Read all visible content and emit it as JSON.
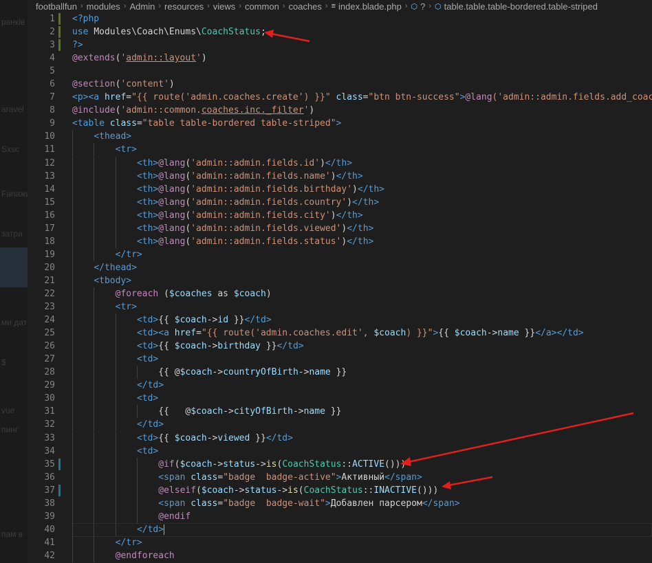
{
  "breadcrumb": [
    {
      "label": "footballfun",
      "icon": ""
    },
    {
      "label": "modules",
      "icon": ""
    },
    {
      "label": "Admin",
      "icon": ""
    },
    {
      "label": "resources",
      "icon": ""
    },
    {
      "label": "views",
      "icon": ""
    },
    {
      "label": "common",
      "icon": ""
    },
    {
      "label": "coaches",
      "icon": ""
    },
    {
      "label": "index.blade.php",
      "icon": "file-lines-icon"
    },
    {
      "label": "?",
      "icon": "cube-icon"
    },
    {
      "label": "table.table.table-bordered.table-striped",
      "icon": "cube-icon"
    }
  ],
  "sidebar_fragments": [
    "ранкiв",
    "aravel",
    "Sxsc",
    "Fanaжи",
    "затра",
    "ми дат",
    "$ ",
    "vue ",
    "пинг",
    "пам в"
  ],
  "colors": {
    "keyword": "#569cd6",
    "tag": "#569cd6",
    "attr": "#9cdcfe",
    "string": "#ce9178",
    "text": "#d4d4d4",
    "directive": "#c586c0",
    "function": "#dcdcaa",
    "class": "#4ec9b0",
    "php": "#569cd6",
    "arrow": "#e0201e"
  },
  "lines": [
    {
      "n": "1",
      "mark": "added",
      "segs": [
        [
          "<?php",
          "php"
        ]
      ]
    },
    {
      "n": "2",
      "mark": "added",
      "segs": [
        [
          "use ",
          "php"
        ],
        [
          "Modules\\Coach\\Enums\\",
          "text"
        ],
        [
          "CoachStatus",
          "class"
        ],
        [
          ";",
          "text"
        ]
      ]
    },
    {
      "n": "3",
      "mark": "added",
      "segs": [
        [
          "?>",
          "php"
        ]
      ]
    },
    {
      "n": "4",
      "segs": [
        [
          "@extends",
          "directive"
        ],
        [
          "(",
          "text"
        ],
        [
          "'",
          "string"
        ],
        [
          "admin::layout",
          "string_u"
        ],
        [
          "'",
          "string"
        ],
        [
          ")",
          "text"
        ]
      ]
    },
    {
      "n": "5",
      "segs": []
    },
    {
      "n": "6",
      "segs": [
        [
          "@section",
          "directive"
        ],
        [
          "(",
          "text"
        ],
        [
          "'content'",
          "string"
        ],
        [
          ")",
          "text"
        ]
      ]
    },
    {
      "n": "7",
      "segs": [
        [
          "<p><a ",
          "tag"
        ],
        [
          "href",
          "attr"
        ],
        [
          "=",
          "text"
        ],
        [
          "\"{{ route('admin.coaches.create') }}\"",
          "string"
        ],
        [
          " ",
          "text"
        ],
        [
          "class",
          "attr"
        ],
        [
          "=",
          "text"
        ],
        [
          "\"btn btn-success\"",
          "string"
        ],
        [
          ">",
          "tag"
        ],
        [
          "@lang",
          "directive"
        ],
        [
          "('admin::admin.fields.add_coach')",
          "string"
        ]
      ]
    },
    {
      "n": "8",
      "segs": [
        [
          "@include",
          "directive"
        ],
        [
          "(",
          "text"
        ],
        [
          "'admin::common.",
          "string"
        ],
        [
          "coaches",
          "string_u"
        ],
        [
          ".inc._filter",
          "string_u2"
        ],
        [
          "'",
          "string"
        ],
        [
          ")",
          "text"
        ]
      ]
    },
    {
      "n": "9",
      "segs": [
        [
          "<table ",
          "tag"
        ],
        [
          "class",
          "attr"
        ],
        [
          "=",
          "text"
        ],
        [
          "\"table table-bordered table-striped\"",
          "string"
        ],
        [
          ">",
          "tag"
        ]
      ]
    },
    {
      "n": "10",
      "indent": 1,
      "segs": [
        [
          "<thead>",
          "tag"
        ]
      ]
    },
    {
      "n": "11",
      "indent": 2,
      "segs": [
        [
          "<tr>",
          "tag"
        ]
      ]
    },
    {
      "n": "12",
      "indent": 3,
      "segs": [
        [
          "<th>",
          "tag"
        ],
        [
          "@lang",
          "directive"
        ],
        [
          "(",
          "text"
        ],
        [
          "'admin::admin.fields.id'",
          "string"
        ],
        [
          ")",
          "text"
        ],
        [
          "</th>",
          "tag"
        ]
      ]
    },
    {
      "n": "13",
      "indent": 3,
      "segs": [
        [
          "<th>",
          "tag"
        ],
        [
          "@lang",
          "directive"
        ],
        [
          "(",
          "text"
        ],
        [
          "'admin::admin.fields.name'",
          "string"
        ],
        [
          ")",
          "text"
        ],
        [
          "</th>",
          "tag"
        ]
      ]
    },
    {
      "n": "14",
      "indent": 3,
      "segs": [
        [
          "<th>",
          "tag"
        ],
        [
          "@lang",
          "directive"
        ],
        [
          "(",
          "text"
        ],
        [
          "'admin::admin.fields.birthday'",
          "string"
        ],
        [
          ")",
          "text"
        ],
        [
          "</th>",
          "tag"
        ]
      ]
    },
    {
      "n": "15",
      "indent": 3,
      "segs": [
        [
          "<th>",
          "tag"
        ],
        [
          "@lang",
          "directive"
        ],
        [
          "(",
          "text"
        ],
        [
          "'admin::admin.fields.country'",
          "string"
        ],
        [
          ")",
          "text"
        ],
        [
          "</th>",
          "tag"
        ]
      ]
    },
    {
      "n": "16",
      "indent": 3,
      "segs": [
        [
          "<th>",
          "tag"
        ],
        [
          "@lang",
          "directive"
        ],
        [
          "(",
          "text"
        ],
        [
          "'admin::admin.fields.city'",
          "string"
        ],
        [
          ")",
          "text"
        ],
        [
          "</th>",
          "tag"
        ]
      ]
    },
    {
      "n": "17",
      "indent": 3,
      "segs": [
        [
          "<th>",
          "tag"
        ],
        [
          "@lang",
          "directive"
        ],
        [
          "(",
          "text"
        ],
        [
          "'admin::admin.fields.viewed'",
          "string"
        ],
        [
          ")",
          "text"
        ],
        [
          "</th>",
          "tag"
        ]
      ]
    },
    {
      "n": "18",
      "indent": 3,
      "segs": [
        [
          "<th>",
          "tag"
        ],
        [
          "@lang",
          "directive"
        ],
        [
          "(",
          "text"
        ],
        [
          "'admin::admin.fields.status'",
          "string"
        ],
        [
          ")",
          "text"
        ],
        [
          "</th>",
          "tag"
        ]
      ]
    },
    {
      "n": "19",
      "indent": 2,
      "segs": [
        [
          "</tr>",
          "tag"
        ]
      ]
    },
    {
      "n": "20",
      "indent": 1,
      "segs": [
        [
          "</thead>",
          "tag"
        ]
      ]
    },
    {
      "n": "21",
      "indent": 1,
      "segs": [
        [
          "<tbody>",
          "tag"
        ]
      ]
    },
    {
      "n": "22",
      "indent": 2,
      "segs": [
        [
          "@foreach",
          "directive"
        ],
        [
          " (",
          "text"
        ],
        [
          "$coaches",
          "attr"
        ],
        [
          " as ",
          "text"
        ],
        [
          "$coach",
          "attr"
        ],
        [
          ")",
          "text"
        ]
      ]
    },
    {
      "n": "23",
      "indent": 2,
      "segs": [
        [
          "<tr>",
          "tag"
        ]
      ]
    },
    {
      "n": "24",
      "indent": 3,
      "segs": [
        [
          "<td>",
          "tag"
        ],
        [
          "{{ ",
          "text"
        ],
        [
          "$coach",
          "attr"
        ],
        [
          "->",
          "text"
        ],
        [
          "id",
          "attr"
        ],
        [
          " }}",
          "text"
        ],
        [
          "</td>",
          "tag"
        ]
      ]
    },
    {
      "n": "25",
      "indent": 3,
      "segs": [
        [
          "<td><a ",
          "tag"
        ],
        [
          "href",
          "attr"
        ],
        [
          "=",
          "text"
        ],
        [
          "\"{{ route('admin.coaches.edit', ",
          "string"
        ],
        [
          "$coach",
          "attr"
        ],
        [
          ") }}\"",
          "string"
        ],
        [
          ">",
          "tag"
        ],
        [
          "{{ ",
          "text"
        ],
        [
          "$coach",
          "attr"
        ],
        [
          "->",
          "text"
        ],
        [
          "name",
          "attr"
        ],
        [
          " }}",
          "text"
        ],
        [
          "</a></td>",
          "tag"
        ]
      ]
    },
    {
      "n": "26",
      "indent": 3,
      "segs": [
        [
          "<td>",
          "tag"
        ],
        [
          "{{ ",
          "text"
        ],
        [
          "$coach",
          "attr"
        ],
        [
          "->",
          "text"
        ],
        [
          "birthday",
          "attr"
        ],
        [
          " }}",
          "text"
        ],
        [
          "</td>",
          "tag"
        ]
      ]
    },
    {
      "n": "27",
      "indent": 3,
      "segs": [
        [
          "<td>",
          "tag"
        ]
      ]
    },
    {
      "n": "28",
      "indent": 4,
      "segs": [
        [
          "{{ @",
          "text"
        ],
        [
          "$coach",
          "attr"
        ],
        [
          "->",
          "text"
        ],
        [
          "countryOfBirth",
          "attr"
        ],
        [
          "->",
          "text"
        ],
        [
          "name",
          "attr"
        ],
        [
          " }}",
          "text"
        ]
      ]
    },
    {
      "n": "29",
      "indent": 3,
      "segs": [
        [
          "</td>",
          "tag"
        ]
      ]
    },
    {
      "n": "30",
      "indent": 3,
      "segs": [
        [
          "<td>",
          "tag"
        ]
      ]
    },
    {
      "n": "31",
      "indent": 4,
      "segs": [
        [
          "{{   @",
          "text"
        ],
        [
          "$coach",
          "attr"
        ],
        [
          "->",
          "text"
        ],
        [
          "cityOfBirth",
          "attr"
        ],
        [
          "->",
          "text"
        ],
        [
          "name",
          "attr"
        ],
        [
          " }}",
          "text"
        ]
      ]
    },
    {
      "n": "32",
      "indent": 3,
      "segs": [
        [
          "</td>",
          "tag"
        ]
      ]
    },
    {
      "n": "33",
      "indent": 3,
      "segs": [
        [
          "<td>",
          "tag"
        ],
        [
          "{{ ",
          "text"
        ],
        [
          "$coach",
          "attr"
        ],
        [
          "->",
          "text"
        ],
        [
          "viewed",
          "attr"
        ],
        [
          " }}",
          "text"
        ],
        [
          "</td>",
          "tag"
        ]
      ]
    },
    {
      "n": "34",
      "indent": 3,
      "segs": [
        [
          "<td>",
          "tag"
        ]
      ]
    },
    {
      "n": "35",
      "indent": 4,
      "mark": "modified",
      "segs": [
        [
          "@if",
          "directive"
        ],
        [
          "(",
          "text"
        ],
        [
          "$coach",
          "attr"
        ],
        [
          "->",
          "text"
        ],
        [
          "status",
          "attr"
        ],
        [
          "->",
          "text"
        ],
        [
          "is",
          "function"
        ],
        [
          "(",
          "text"
        ],
        [
          "CoachStatus",
          "class"
        ],
        [
          "::",
          "text"
        ],
        [
          "ACTIVE",
          "attr"
        ],
        [
          "()))",
          "text"
        ]
      ]
    },
    {
      "n": "36",
      "indent": 4,
      "segs": [
        [
          "<span ",
          "tag"
        ],
        [
          "class",
          "attr"
        ],
        [
          "=",
          "text"
        ],
        [
          "\"badge  badge-active\"",
          "string"
        ],
        [
          ">",
          "tag"
        ],
        [
          "Активный",
          "text"
        ],
        [
          "</span>",
          "tag"
        ]
      ]
    },
    {
      "n": "37",
      "indent": 4,
      "mark": "modified",
      "segs": [
        [
          "@elseif",
          "directive"
        ],
        [
          "(",
          "text"
        ],
        [
          "$coach",
          "attr"
        ],
        [
          "->",
          "text"
        ],
        [
          "status",
          "attr"
        ],
        [
          "->",
          "text"
        ],
        [
          "is",
          "function"
        ],
        [
          "(",
          "text"
        ],
        [
          "CoachStatus",
          "class"
        ],
        [
          "::",
          "text"
        ],
        [
          "INACTIVE",
          "attr"
        ],
        [
          "()))",
          "text"
        ]
      ]
    },
    {
      "n": "38",
      "indent": 4,
      "segs": [
        [
          "<span ",
          "tag"
        ],
        [
          "class",
          "attr"
        ],
        [
          "=",
          "text"
        ],
        [
          "\"badge  badge-wait\"",
          "string"
        ],
        [
          ">",
          "tag"
        ],
        [
          "Добавлен парсером",
          "text"
        ],
        [
          "</span>",
          "tag"
        ]
      ]
    },
    {
      "n": "39",
      "indent": 4,
      "segs": [
        [
          "@endif",
          "directive"
        ]
      ]
    },
    {
      "n": "40",
      "indent": 3,
      "cursor": true,
      "segs": [
        [
          "</td>",
          "tag"
        ]
      ]
    },
    {
      "n": "41",
      "indent": 2,
      "segs": [
        [
          "</tr>",
          "tag"
        ]
      ]
    },
    {
      "n": "42",
      "indent": 2,
      "segs": [
        [
          "@endforeach",
          "directive"
        ]
      ]
    }
  ]
}
